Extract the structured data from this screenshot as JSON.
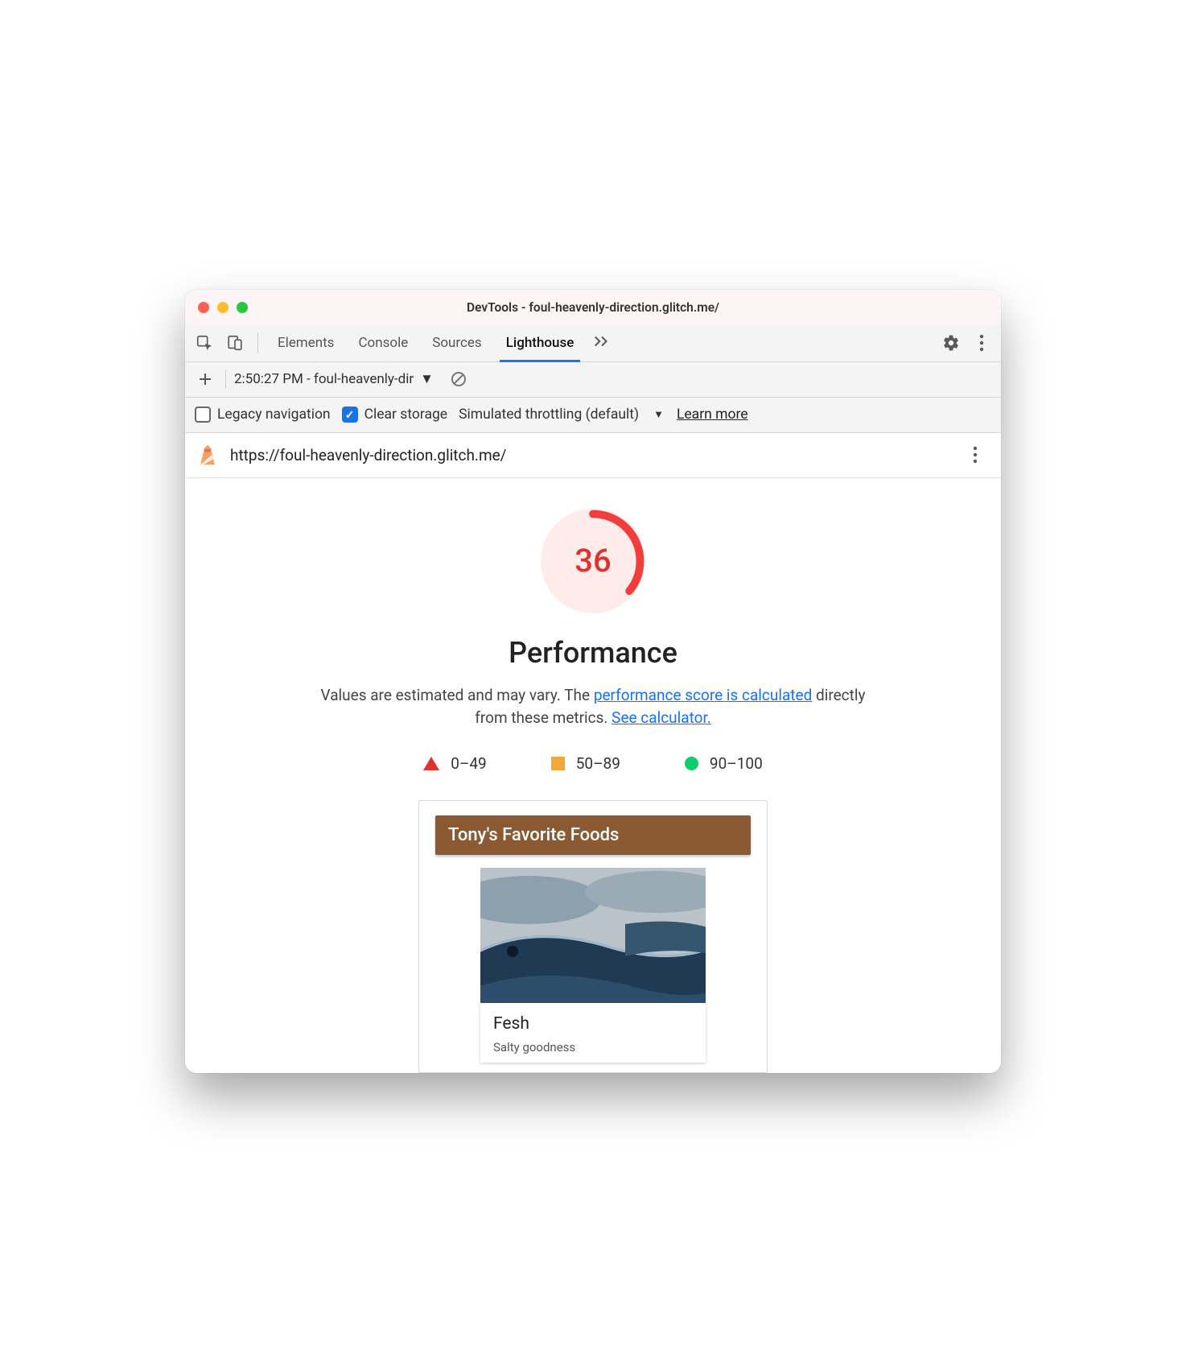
{
  "window": {
    "title": "DevTools - foul-heavenly-direction.glitch.me/"
  },
  "devtools": {
    "tabs": [
      "Elements",
      "Console",
      "Sources",
      "Lighthouse"
    ],
    "active_tab_index": 3
  },
  "lh_toolbar": {
    "report_label": "2:50:27 PM - foul-heavenly-dir",
    "legacy_nav_label": "Legacy navigation",
    "legacy_nav_checked": false,
    "clear_storage_label": "Clear storage",
    "clear_storage_checked": true,
    "throttling_label": "Simulated throttling (default)",
    "learn_more_label": "Learn more"
  },
  "report": {
    "url": "https://foul-heavenly-direction.glitch.me/",
    "score": "36",
    "category_title": "Performance",
    "desc_prefix": "Values are estimated and may vary. The ",
    "desc_link1": "performance score is calculated",
    "desc_mid": " directly from these metrics. ",
    "desc_link2": "See calculator.",
    "legend": {
      "fail": "0–49",
      "avg": "50–89",
      "pass": "90–100"
    },
    "screenshot": {
      "header": "Tony's Favorite Foods",
      "card_title": "Fesh",
      "card_subtitle": "Salty goodness"
    }
  },
  "colors": {
    "fail": "#e03131",
    "avg": "#f3a73b",
    "pass": "#0cce6b",
    "link": "#1a73e8",
    "header_brown": "#8b5a33"
  }
}
